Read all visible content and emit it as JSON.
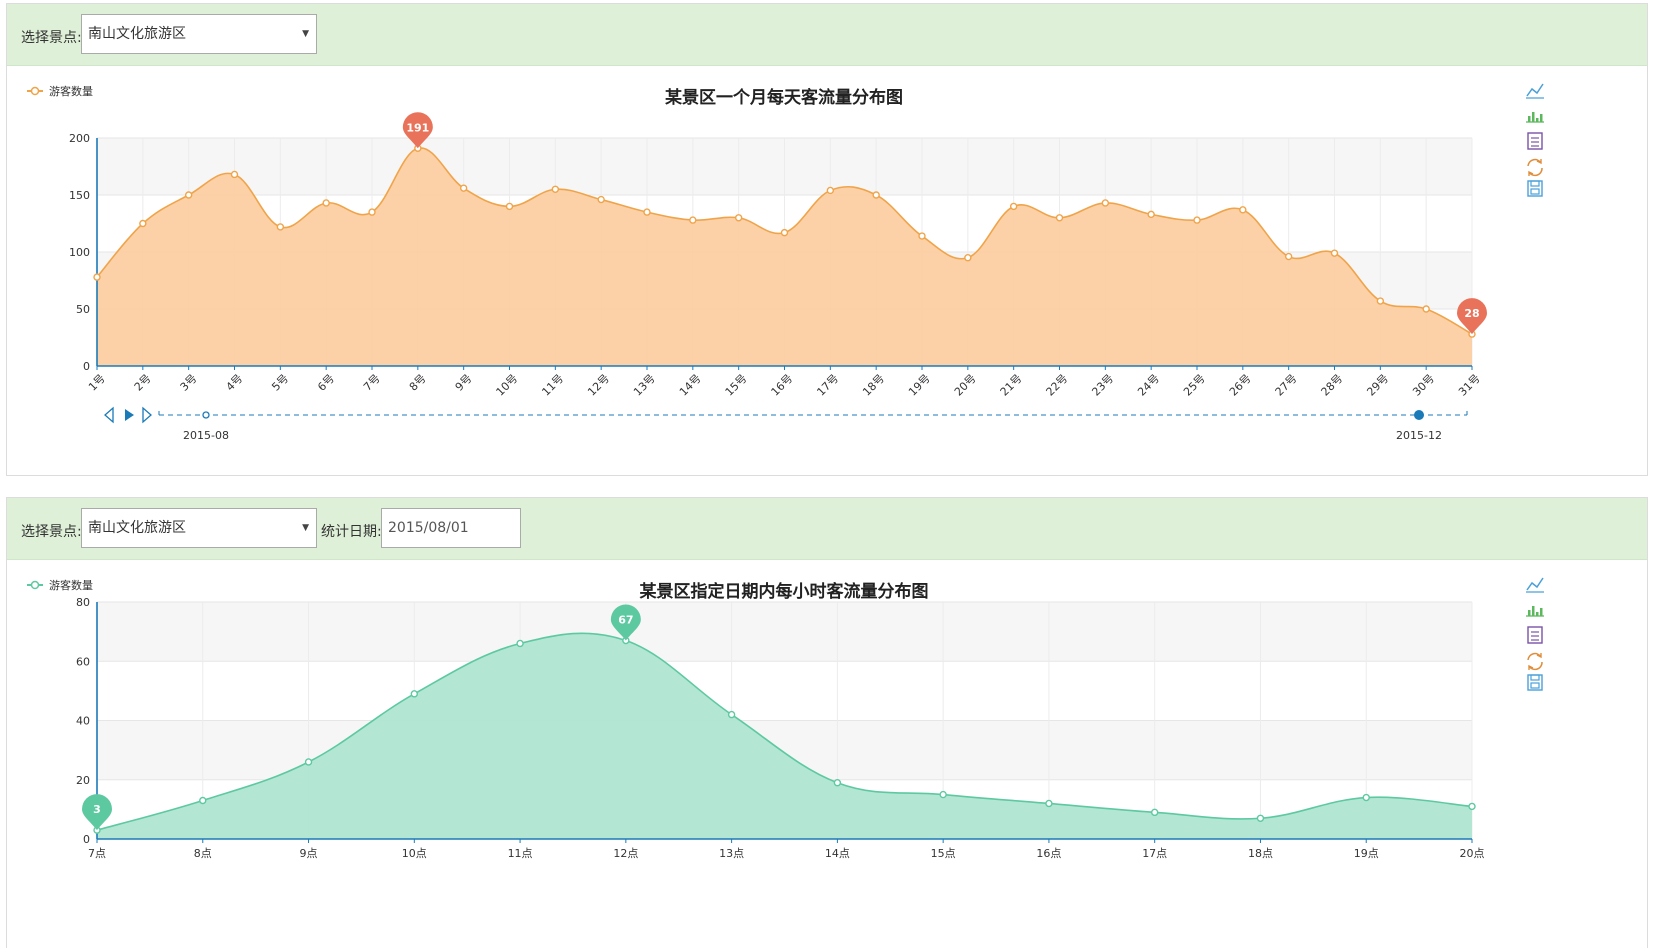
{
  "panel1": {
    "filter": {
      "scenic_label": "选择景点:",
      "scenic_value": "南山文化旅游区"
    },
    "toolbox": {
      "line_icon": "line-chart-icon",
      "bar_icon": "bar-chart-icon",
      "data_view_icon": "data-view-icon",
      "restore_icon": "restore-icon",
      "save_icon": "save-image-icon"
    },
    "timeline": {
      "start_label": "2015-08",
      "end_label": "2015-12",
      "current_position": 0.2
    },
    "chart_data": {
      "type": "area",
      "title": "某景区一个月每天客流量分布图",
      "legend": [
        "游客数量"
      ],
      "legend_position": "top-left",
      "color": "#f0a44a",
      "fill": "#fccfa2",
      "categories": [
        "1号",
        "2号",
        "3号",
        "4号",
        "5号",
        "6号",
        "7号",
        "8号",
        "9号",
        "10号",
        "11号",
        "12号",
        "13号",
        "14号",
        "15号",
        "16号",
        "17号",
        "18号",
        "19号",
        "20号",
        "21号",
        "22号",
        "23号",
        "24号",
        "25号",
        "26号",
        "27号",
        "28号",
        "29号",
        "30号",
        "31号"
      ],
      "series": [
        {
          "name": "游客数量",
          "values": [
            78,
            125,
            150,
            168,
            122,
            143,
            135,
            191,
            156,
            140,
            155,
            146,
            135,
            128,
            130,
            117,
            154,
            150,
            114,
            95,
            140,
            130,
            143,
            133,
            128,
            137,
            96,
            99,
            57,
            50,
            28
          ]
        }
      ],
      "ylim": [
        0,
        200
      ],
      "yticks": [
        0,
        50,
        100,
        150,
        200
      ],
      "grid": true,
      "markers": [
        {
          "label": "191",
          "index": 7,
          "value": 191,
          "color": "#e8735a"
        },
        {
          "label": "28",
          "index": 30,
          "value": 28,
          "color": "#e8735a"
        }
      ]
    }
  },
  "panel2": {
    "filter": {
      "scenic_label": "选择景点:",
      "scenic_value": "南山文化旅游区",
      "date_label": "统计日期:",
      "date_value": "2015/08/01"
    },
    "toolbox": {
      "line_icon": "line-chart-icon",
      "bar_icon": "bar-chart-icon",
      "data_view_icon": "data-view-icon",
      "restore_icon": "restore-icon",
      "save_icon": "save-image-icon"
    },
    "chart_data": {
      "type": "area",
      "title": "某景区指定日期内每小时客流量分布图",
      "legend": [
        "游客数量"
      ],
      "legend_position": "top-left",
      "color": "#5dc9a1",
      "fill": "#b0e5d2",
      "categories": [
        "7点",
        "8点",
        "9点",
        "10点",
        "11点",
        "12点",
        "13点",
        "14点",
        "15点",
        "16点",
        "17点",
        "18点",
        "19点",
        "20点"
      ],
      "series": [
        {
          "name": "游客数量",
          "values": [
            3,
            13,
            26,
            49,
            66,
            67,
            42,
            19,
            15,
            12,
            9,
            7,
            14,
            11
          ]
        }
      ],
      "ylim": [
        0,
        80
      ],
      "yticks": [
        0,
        20,
        40,
        60,
        80
      ],
      "grid": true,
      "markers": [
        {
          "label": "67",
          "index": 5,
          "value": 67,
          "color": "#5dc9a1"
        },
        {
          "label": "3",
          "index": 0,
          "value": 3,
          "color": "#5dc9a1"
        }
      ]
    }
  }
}
